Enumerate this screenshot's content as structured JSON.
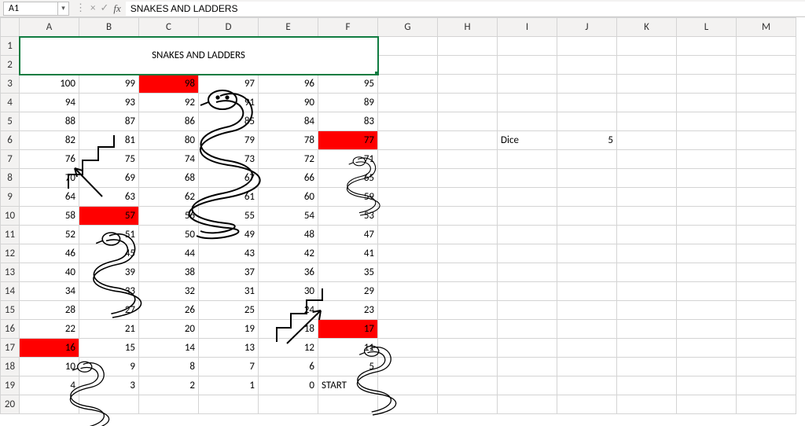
{
  "namebox": {
    "value": "A1"
  },
  "formula_bar": {
    "cancel": "×",
    "enter": "✓",
    "fx": "fx",
    "value": "SNAKES AND LADDERS"
  },
  "columns": [
    "A",
    "B",
    "C",
    "D",
    "E",
    "F",
    "G",
    "H",
    "I",
    "J",
    "K",
    "L",
    "M"
  ],
  "rows": [
    "1",
    "2",
    "3",
    "4",
    "5",
    "6",
    "7",
    "8",
    "9",
    "10",
    "11",
    "12",
    "13",
    "14",
    "15",
    "16",
    "17",
    "18",
    "19",
    "20"
  ],
  "title": "SNAKES AND LADDERS",
  "dice": {
    "label": "Dice",
    "value": "5"
  },
  "start_label": "START",
  "board": {
    "r3": {
      "A": "100",
      "B": "99",
      "C": "98",
      "D": "97",
      "E": "96",
      "F": "95"
    },
    "r4": {
      "A": "94",
      "B": "93",
      "C": "92",
      "D": "91",
      "E": "90",
      "F": "89"
    },
    "r5": {
      "A": "88",
      "B": "87",
      "C": "86",
      "D": "85",
      "E": "84",
      "F": "83"
    },
    "r6": {
      "A": "82",
      "B": "81",
      "C": "80",
      "D": "79",
      "E": "78",
      "F": "77"
    },
    "r7": {
      "A": "76",
      "B": "75",
      "C": "74",
      "D": "73",
      "E": "72",
      "F": "71"
    },
    "r8": {
      "A": "70",
      "B": "69",
      "C": "68",
      "D": "67",
      "E": "66",
      "F": "65"
    },
    "r9": {
      "A": "64",
      "B": "63",
      "C": "62",
      "D": "61",
      "E": "60",
      "F": "59"
    },
    "r10": {
      "A": "58",
      "B": "57",
      "C": "56",
      "D": "55",
      "E": "54",
      "F": "53"
    },
    "r11": {
      "A": "52",
      "B": "51",
      "C": "50",
      "D": "49",
      "E": "48",
      "F": "47"
    },
    "r12": {
      "A": "46",
      "B": "45",
      "C": "44",
      "D": "43",
      "E": "42",
      "F": "41"
    },
    "r13": {
      "A": "40",
      "B": "39",
      "C": "38",
      "D": "37",
      "E": "36",
      "F": "35"
    },
    "r14": {
      "A": "34",
      "B": "33",
      "C": "32",
      "D": "31",
      "E": "30",
      "F": "29"
    },
    "r15": {
      "A": "28",
      "B": "27",
      "C": "26",
      "D": "25",
      "E": "24",
      "F": "23"
    },
    "r16": {
      "A": "22",
      "B": "21",
      "C": "20",
      "D": "19",
      "E": "18",
      "F": "17"
    },
    "r17": {
      "A": "16",
      "B": "15",
      "C": "14",
      "D": "13",
      "E": "12",
      "F": "11"
    },
    "r18": {
      "A": "10",
      "B": "9",
      "C": "8",
      "D": "7",
      "E": "6",
      "F": "5"
    },
    "r19": {
      "A": "4",
      "B": "3",
      "C": "2",
      "D": "1",
      "E": "0"
    }
  },
  "red_cells": [
    "C3",
    "F6",
    "B10",
    "F16",
    "A17"
  ],
  "colors": {
    "red": "#ff0000",
    "selection": "#107c41"
  }
}
